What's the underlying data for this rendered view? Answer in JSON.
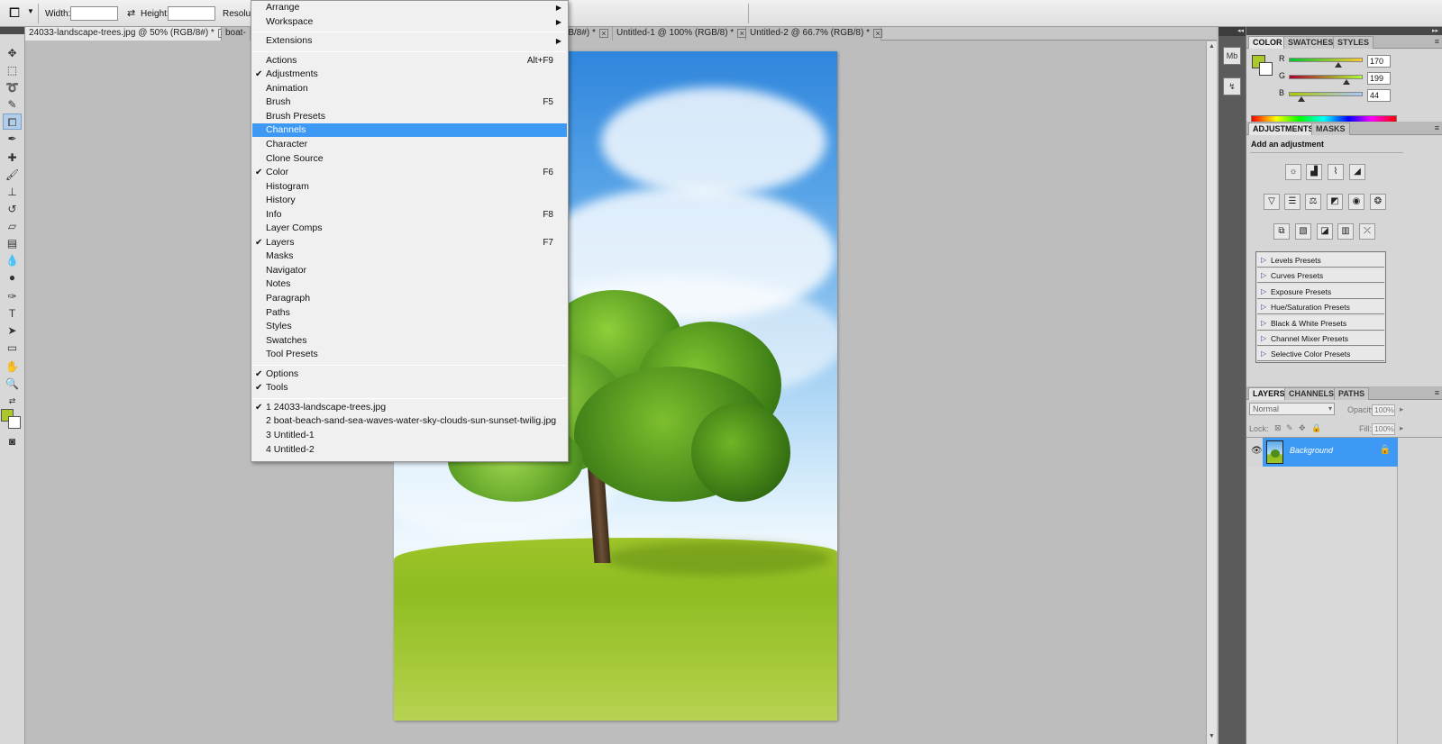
{
  "options_bar": {
    "tool_icon": "crop-icon",
    "width_label": "Width:",
    "height_label": "Height:",
    "resolution_label": "Resolutio"
  },
  "doc_tabs": [
    {
      "label": "24033-landscape-trees.jpg @ 50% (RGB/8#) *",
      "active": true
    },
    {
      "label": "boat-",
      "active": false
    },
    {
      "label": "(RGB/8#) *",
      "active": false
    },
    {
      "label": "Untitled-1 @ 100% (RGB/8) *",
      "active": false
    },
    {
      "label": "Untitled-2 @ 66.7% (RGB/8) *",
      "active": false
    }
  ],
  "window_menu": {
    "groups": [
      [
        {
          "label": "Arrange",
          "submenu": true
        },
        {
          "label": "Workspace",
          "submenu": true
        }
      ],
      [
        {
          "label": "Extensions",
          "submenu": true
        }
      ],
      [
        {
          "label": "Actions",
          "shortcut": "Alt+F9"
        },
        {
          "label": "Adjustments",
          "checked": true
        },
        {
          "label": "Animation"
        },
        {
          "label": "Brush",
          "shortcut": "F5"
        },
        {
          "label": "Brush Presets"
        },
        {
          "label": "Channels",
          "highlighted": true
        },
        {
          "label": "Character"
        },
        {
          "label": "Clone Source"
        },
        {
          "label": "Color",
          "checked": true,
          "shortcut": "F6"
        },
        {
          "label": "Histogram"
        },
        {
          "label": "History"
        },
        {
          "label": "Info",
          "shortcut": "F8"
        },
        {
          "label": "Layer Comps"
        },
        {
          "label": "Layers",
          "checked": true,
          "shortcut": "F7"
        },
        {
          "label": "Masks"
        },
        {
          "label": "Navigator"
        },
        {
          "label": "Notes"
        },
        {
          "label": "Paragraph"
        },
        {
          "label": "Paths"
        },
        {
          "label": "Styles"
        },
        {
          "label": "Swatches"
        },
        {
          "label": "Tool Presets"
        }
      ],
      [
        {
          "label": "Options",
          "checked": true
        },
        {
          "label": "Tools",
          "checked": true
        }
      ],
      [
        {
          "label": "1 24033-landscape-trees.jpg",
          "checked": true
        },
        {
          "label": "2 boat-beach-sand-sea-waves-water-sky-clouds-sun-sunset-twilig.jpg"
        },
        {
          "label": "3 Untitled-1"
        },
        {
          "label": "4 Untitled-2"
        }
      ]
    ]
  },
  "color_panel": {
    "tabs": [
      "COLOR",
      "SWATCHES",
      "STYLES"
    ],
    "rows": [
      {
        "label": "R",
        "value": "170",
        "level": 0.667,
        "gradient": "linear-gradient(90deg,#00c72c,#ffc72c)"
      },
      {
        "label": "G",
        "value": "199",
        "level": 0.78,
        "gradient": "linear-gradient(90deg,#aa002c,#aaff2c)"
      },
      {
        "label": "B",
        "value": "44",
        "level": 0.173,
        "gradient": "linear-gradient(90deg,#aac700,#aac7ff)"
      }
    ],
    "foreground_color": "#aac72c",
    "background_color": "#ffffff"
  },
  "adjustments_panel": {
    "tabs": [
      "ADJUSTMENTS",
      "MASKS"
    ],
    "title": "Add an adjustment",
    "presets": [
      "Levels Presets",
      "Curves Presets",
      "Exposure Presets",
      "Hue/Saturation Presets",
      "Black & White Presets",
      "Channel Mixer Presets",
      "Selective Color Presets"
    ]
  },
  "layers_panel": {
    "tabs": [
      "LAYERS",
      "CHANNELS",
      "PATHS"
    ],
    "blend_mode": "Normal",
    "opacity_label": "Opacity:",
    "opacity_value": "100%",
    "lock_label": "Lock:",
    "fill_label": "Fill:",
    "fill_value": "100%",
    "layer_name": "Background"
  },
  "accent_color": "#3d99f4"
}
